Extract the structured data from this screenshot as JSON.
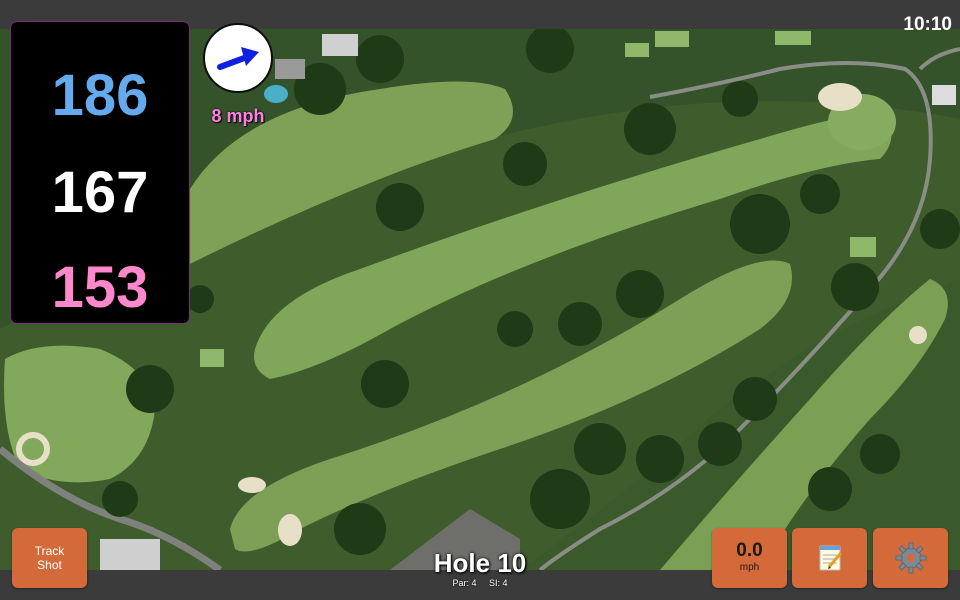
{
  "status": {
    "time": "10:10"
  },
  "distances": {
    "back": "186",
    "middle": "167",
    "front": "153"
  },
  "wind": {
    "speed_label": "8 mph",
    "dial_icon": "wind-direction-arrow-icon"
  },
  "buttons": {
    "track_shot_line1": "Track",
    "track_shot_line2": "Shot",
    "wind_value": "0.0",
    "wind_unit": "mph",
    "notes_icon": "notepad-icon",
    "settings_icon": "gear-icon"
  },
  "hole": {
    "title": "Hole 10",
    "par": "Par: 4",
    "si": "SI: 4"
  },
  "colors": {
    "back_distance": "#66aaee",
    "middle_distance": "#ffffff",
    "front_distance": "#ff88cc",
    "wind_label": "#ff7fe6",
    "button": "#d46a3a"
  }
}
